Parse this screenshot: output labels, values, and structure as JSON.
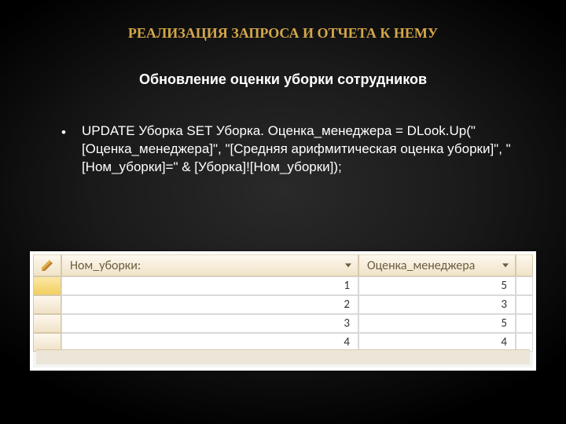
{
  "title": "РЕАЛИЗАЦИЯ ЗАПРОСА И ОТЧЕТА К НЕМУ",
  "subtitle": "Обновление оценки уборки сотрудников",
  "bullet": "UPDATE Уборка SET Уборка. Оценка_менеджера = DLook.Up(\"[Оценка_менеджера]\", \"[Средняя арифмитическая оценка уборки]\", \"[Ном_уборки]=\" & [Уборка]![Ном_уборки]);",
  "table": {
    "columns": [
      "Ном_уборки:",
      "Оценка_менеджера"
    ],
    "rows": [
      {
        "nom": "1",
        "score": "5"
      },
      {
        "nom": "2",
        "score": "3"
      },
      {
        "nom": "3",
        "score": "5"
      },
      {
        "nom": "4",
        "score": "4"
      }
    ]
  }
}
